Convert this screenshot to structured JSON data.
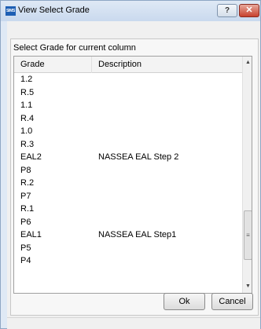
{
  "window": {
    "app_icon_text": "SIMS",
    "title": "View Select Grade",
    "help_label": "?",
    "close_label": "✕"
  },
  "panel": {
    "caption": "Select Grade for current column"
  },
  "grid": {
    "columns": [
      "Grade",
      "Description"
    ],
    "rows": [
      {
        "grade": "1.2",
        "description": ""
      },
      {
        "grade": "R.5",
        "description": ""
      },
      {
        "grade": "1.1",
        "description": ""
      },
      {
        "grade": "R.4",
        "description": ""
      },
      {
        "grade": "1.0",
        "description": ""
      },
      {
        "grade": "R.3",
        "description": ""
      },
      {
        "grade": "EAL2",
        "description": "NASSEA EAL Step 2"
      },
      {
        "grade": "P8",
        "description": ""
      },
      {
        "grade": "R.2",
        "description": ""
      },
      {
        "grade": "P7",
        "description": ""
      },
      {
        "grade": "R.1",
        "description": ""
      },
      {
        "grade": "P6",
        "description": ""
      },
      {
        "grade": "EAL1",
        "description": "NASSEA EAL Step1"
      },
      {
        "grade": "P5",
        "description": ""
      },
      {
        "grade": "P4",
        "description": ""
      }
    ],
    "scroll_up_icon": "▲",
    "scroll_down_icon": "▼",
    "thumb_grip_icon": "≡"
  },
  "buttons": {
    "ok": "Ok",
    "cancel": "Cancel"
  }
}
